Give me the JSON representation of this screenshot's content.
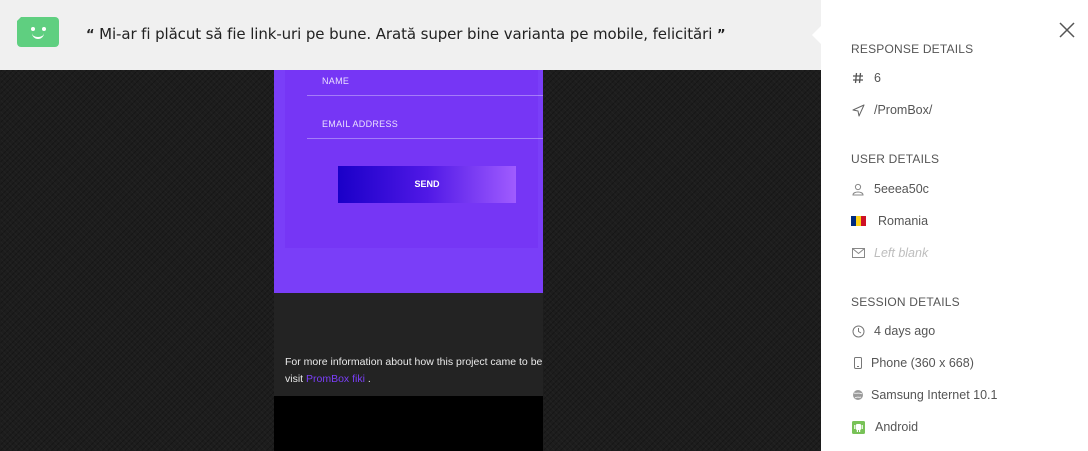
{
  "feedback": {
    "quote_open": "“",
    "text": "Mi-ar fi plăcut să fie link-uri pe bune. Arată super bine varianta pe mobile, felicitări",
    "quote_close": "”"
  },
  "screenshot": {
    "name_placeholder": "NAME",
    "email_placeholder": "EMAIL ADDRESS",
    "send_label": "SEND",
    "info_line1": "For more information about how this project came to be",
    "info_line2_prefix": "visit ",
    "info_link": "PromBox fiki",
    "info_line2_suffix": " ."
  },
  "panel": {
    "response_title": "RESPONSE DETAILS",
    "response_number": "6",
    "response_path": "/PromBox/",
    "user_title": "USER DETAILS",
    "user_id": "5eeea50c",
    "country": "Romania",
    "country_flag_colors": [
      "#002b7f",
      "#fcd116",
      "#ce1126"
    ],
    "email": "Left blank",
    "session_title": "SESSION DETAILS",
    "time_ago": "4 days ago",
    "device": "Phone (360 x 668)",
    "browser": "Samsung Internet 10.1",
    "os": "Android"
  },
  "colors": {
    "accent_purple": "#7a3ef8",
    "face_green": "#5fcf80",
    "android_green": "#78c257"
  }
}
